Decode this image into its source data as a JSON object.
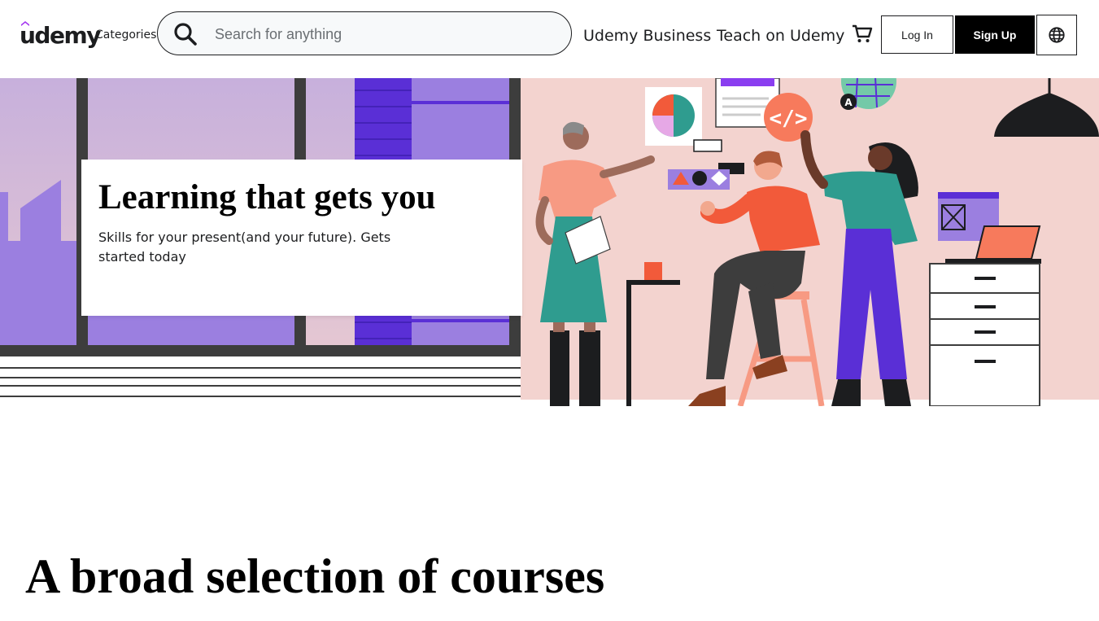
{
  "header": {
    "logo_text": "udemy",
    "categories_label": "Categories",
    "search": {
      "placeholder": "Search for anything",
      "value": ""
    },
    "nav": {
      "business_label": "Udemy Business",
      "teach_label": "Teach on Udemy"
    },
    "login_label": "Log In",
    "signup_label": "Sign Up",
    "icons": {
      "search": "search-icon",
      "cart": "cart-icon",
      "language": "globe-icon"
    }
  },
  "hero": {
    "title": "Learning that gets you",
    "subtitle": "Skills for your present(and your future). Gets started today"
  },
  "section": {
    "title": "A broad selection of courses"
  },
  "colors": {
    "brand_purple": "#a435f0",
    "hero_pink": "#f3d3cf",
    "window_purple": "#9b7fe0",
    "signup_bg": "#000000"
  }
}
